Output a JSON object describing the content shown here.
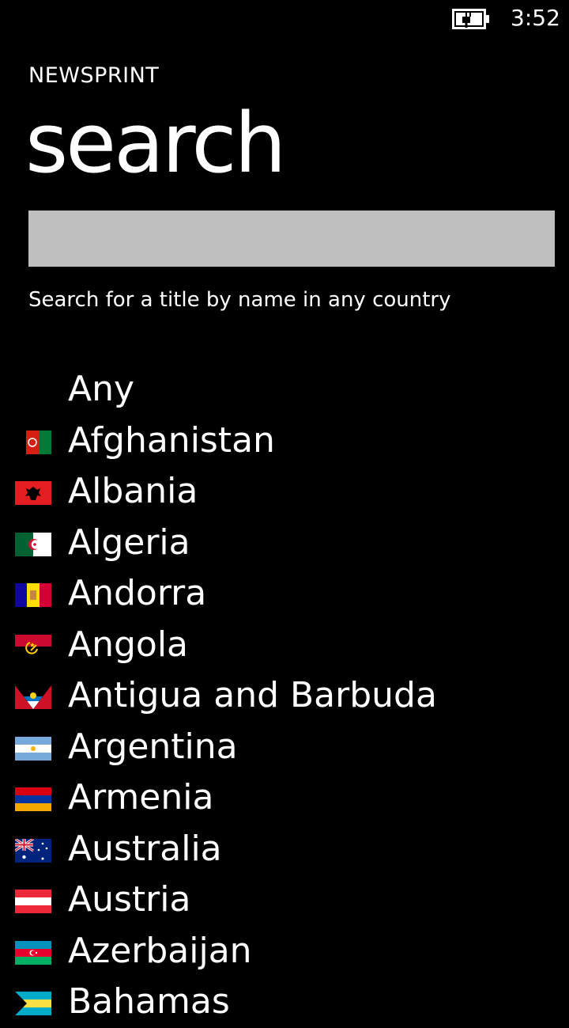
{
  "status": {
    "time": "3:52",
    "battery_icon": "battery-charging-icon"
  },
  "app": {
    "name": "NEWSPRINT"
  },
  "page": {
    "title": "search",
    "hint": "Search for a title by name in any country"
  },
  "search": {
    "value": "",
    "placeholder": ""
  },
  "countries": [
    {
      "name": "Any",
      "flag": "none"
    },
    {
      "name": "Afghanistan",
      "flag": "afghanistan-flag-icon"
    },
    {
      "name": "Albania",
      "flag": "albania-flag-icon"
    },
    {
      "name": "Algeria",
      "flag": "algeria-flag-icon"
    },
    {
      "name": "Andorra",
      "flag": "andorra-flag-icon"
    },
    {
      "name": "Angola",
      "flag": "angola-flag-icon"
    },
    {
      "name": "Antigua and Barbuda",
      "flag": "antigua-flag-icon"
    },
    {
      "name": "Argentina",
      "flag": "argentina-flag-icon"
    },
    {
      "name": "Armenia",
      "flag": "armenia-flag-icon"
    },
    {
      "name": "Australia",
      "flag": "australia-flag-icon"
    },
    {
      "name": "Austria",
      "flag": "austria-flag-icon"
    },
    {
      "name": "Azerbaijan",
      "flag": "azerbaijan-flag-icon"
    },
    {
      "name": "Bahamas",
      "flag": "bahamas-flag-icon"
    }
  ]
}
